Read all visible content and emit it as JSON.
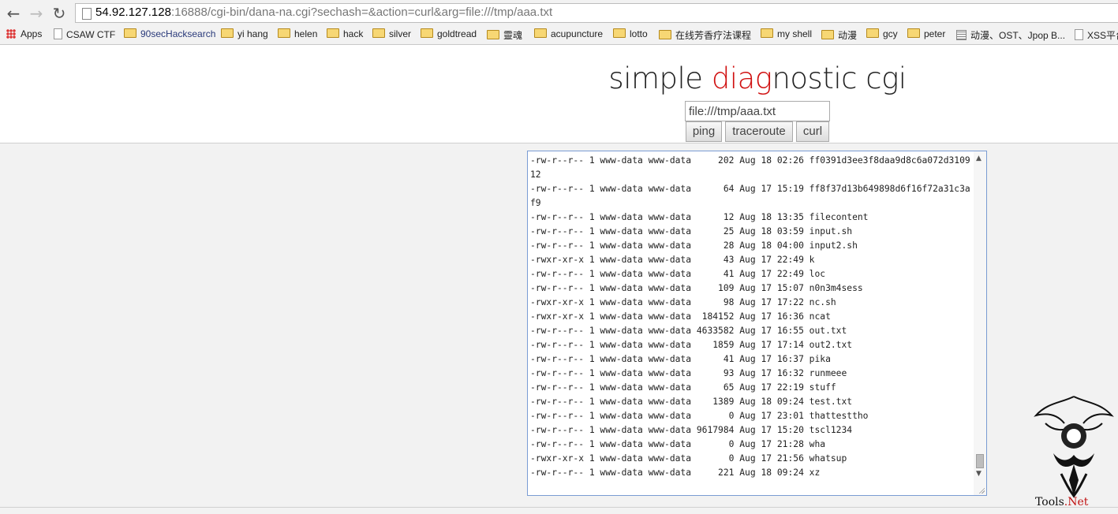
{
  "browser": {
    "url_host": "54.92.127.128",
    "url_rest": ":16888/cgi-bin/dana-na.cgi?sechash=&action=curl&arg=file:///tmp/aaa.txt",
    "back_icon": "arrow-left-icon",
    "forward_icon": "arrow-right-icon",
    "reload_icon": "reload-icon"
  },
  "bookmarks": [
    {
      "label": "Apps",
      "icon": "apps-grid-icon"
    },
    {
      "label": "CSAW CTF",
      "icon": "page-icon"
    },
    {
      "label": "90secHacksearch",
      "icon": "folder-icon"
    },
    {
      "label": "yi hang",
      "icon": "folder-icon"
    },
    {
      "label": "helen",
      "icon": "folder-icon"
    },
    {
      "label": "hack",
      "icon": "folder-icon"
    },
    {
      "label": "silver",
      "icon": "folder-icon"
    },
    {
      "label": "goldtread",
      "icon": "folder-icon"
    },
    {
      "label": "靈魂",
      "icon": "folder-icon"
    },
    {
      "label": "acupuncture",
      "icon": "folder-icon"
    },
    {
      "label": "lotto",
      "icon": "folder-icon"
    },
    {
      "label": "在线芳香疗法课程",
      "icon": "folder-icon"
    },
    {
      "label": "my shell",
      "icon": "folder-icon"
    },
    {
      "label": "动漫",
      "icon": "folder-icon"
    },
    {
      "label": "gcy",
      "icon": "folder-icon"
    },
    {
      "label": "peter",
      "icon": "folder-icon"
    },
    {
      "label": "动漫、OST、Jpop B...",
      "icon": "grid-page-icon"
    },
    {
      "label": "XSS平台",
      "icon": "page-icon"
    }
  ],
  "page": {
    "title_a": "simple ",
    "title_b": "diag",
    "title_c": "nostic cgi",
    "arg_value": "file:///tmp/aaa.txt",
    "buttons": {
      "ping": "ping",
      "traceroute": "traceroute",
      "curl": "curl"
    }
  },
  "output_lines": [
    "-rw-r--r-- 1 www-data www-data     202 Aug 18 02:26 ff0391d3ee3f8daa9d8c6a072d310912",
    "-rw-r--r-- 1 www-data www-data      64 Aug 17 15:19 ff8f37d13b649898d6f16f72a31c3af9",
    "-rw-r--r-- 1 www-data www-data      12 Aug 18 13:35 filecontent",
    "-rw-r--r-- 1 www-data www-data      25 Aug 18 03:59 input.sh",
    "-rw-r--r-- 1 www-data www-data      28 Aug 18 04:00 input2.sh",
    "-rwxr-xr-x 1 www-data www-data      43 Aug 17 22:49 k",
    "-rw-r--r-- 1 www-data www-data      41 Aug 17 22:49 loc",
    "-rw-r--r-- 1 www-data www-data     109 Aug 17 15:07 n0n3m4sess",
    "-rwxr-xr-x 1 www-data www-data      98 Aug 17 17:22 nc.sh",
    "-rwxr-xr-x 1 www-data www-data  184152 Aug 17 16:36 ncat",
    "-rw-r--r-- 1 www-data www-data 4633582 Aug 17 16:55 out.txt",
    "-rw-r--r-- 1 www-data www-data    1859 Aug 17 17:14 out2.txt",
    "-rw-r--r-- 1 www-data www-data      41 Aug 17 16:37 pika",
    "-rw-r--r-- 1 www-data www-data      93 Aug 17 16:32 runmeee",
    "-rw-r--r-- 1 www-data www-data      65 Aug 17 22:19 stuff",
    "-rw-r--r-- 1 www-data www-data    1389 Aug 18 09:24 test.txt",
    "-rw-r--r-- 1 www-data www-data       0 Aug 17 23:01 thattesttho",
    "-rw-r--r-- 1 www-data www-data 9617984 Aug 17 15:20 tscl1234",
    "-rw-r--r-- 1 www-data www-data       0 Aug 17 21:28 wha",
    "-rwxr-xr-x 1 www-data www-data       0 Aug 17 21:56 whatsup",
    "-rw-r--r-- 1 www-data www-data     221 Aug 18 09:24 xz"
  ],
  "watermark": {
    "prefix": "T",
    "mid": "ools",
    "dot": ".",
    "suffix": "Net",
    "icon": "dragon-emblem-icon"
  },
  "colors": {
    "accent_red": "#d01010",
    "textarea_border": "#7a9cd3"
  }
}
